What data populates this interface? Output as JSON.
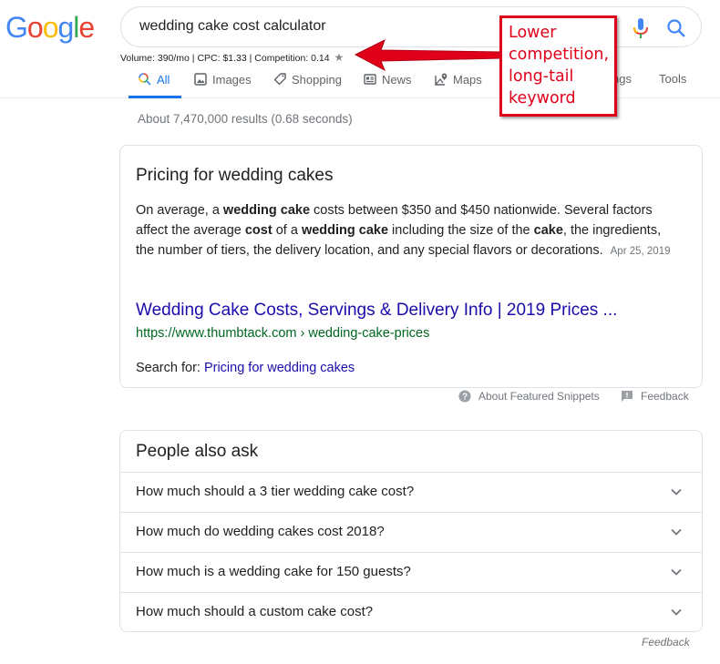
{
  "logo": {
    "letters": [
      "G",
      "o",
      "o",
      "g",
      "l",
      "e"
    ]
  },
  "search": {
    "query": "wedding cake cost calculator"
  },
  "keyword_metrics": {
    "text": "Volume: 390/mo | CPC: $1.33 | Competition: 0.14",
    "star": "★"
  },
  "tabs": [
    {
      "label": "All",
      "icon": "search-icon",
      "active": true
    },
    {
      "label": "Images",
      "icon": "image-icon"
    },
    {
      "label": "Shopping",
      "icon": "tag-icon"
    },
    {
      "label": "News",
      "icon": "news-icon"
    },
    {
      "label": "Maps",
      "icon": "map-icon"
    },
    {
      "label": "Settings",
      "visible_text": "ngs"
    },
    {
      "label": "Tools"
    }
  ],
  "result_stats": "About 7,470,000 results (0.68 seconds)",
  "featured_snippet": {
    "title": "Pricing for wedding cakes",
    "desc_parts": [
      "On average, a ",
      "wedding cake",
      " costs between $350 and $450 nationwide. Several factors affect the average ",
      "cost",
      " of a ",
      "wedding cake",
      " including the size of the ",
      "cake",
      ", the ingredients, the number of tiers, the delivery location, and any special flavors or decorations."
    ],
    "date": "Apr 25, 2019",
    "link_title": "Wedding Cake Costs, Servings & Delivery Info | 2019 Prices ...",
    "url": "https://www.thumbtack.com › wedding-cake-prices",
    "search_for_label": "Search for: ",
    "search_for_link": "Pricing for wedding cakes"
  },
  "snippet_footer": {
    "about": "About Featured Snippets",
    "feedback": "Feedback"
  },
  "people_also_ask": {
    "title": "People also ask",
    "questions": [
      "How much should a 3 tier wedding cake cost?",
      "How much do wedding cakes cost 2018?",
      "How much is a wedding cake for 150 guests?",
      "How much should a custom cake cost?"
    ],
    "feedback": "Feedback"
  },
  "annotation": {
    "text": "Lower competition, long-tail keyword",
    "color": "#e0001a"
  }
}
